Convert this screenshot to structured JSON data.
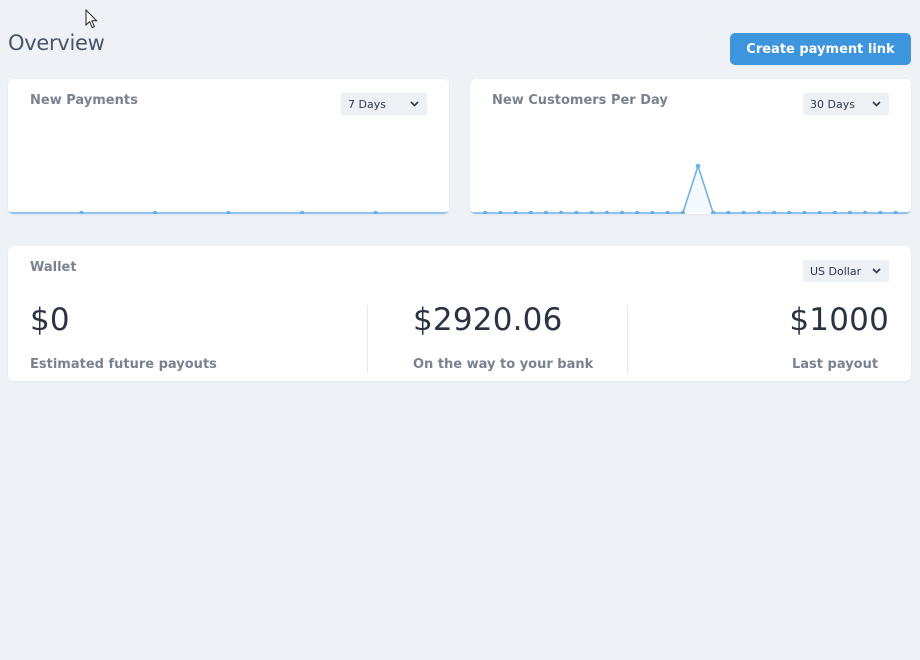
{
  "page": {
    "title": "Overview",
    "create_button_label": "Create payment link"
  },
  "new_payments": {
    "title": "New Payments",
    "range_select": "7 Days"
  },
  "new_customers": {
    "title": "New Customers Per Day",
    "range_select": "30 Days"
  },
  "wallet": {
    "title": "Wallet",
    "currency_select": "US Dollar",
    "stats": [
      {
        "amount": "$0",
        "label": "Estimated future payouts"
      },
      {
        "amount": "$2920.06",
        "label": "On the way to your bank"
      },
      {
        "amount": "$1000",
        "label": "Last payout"
      }
    ]
  },
  "chart_data": [
    {
      "type": "line",
      "title": "New Payments",
      "series": [
        {
          "values": [
            0,
            0,
            0,
            0,
            0,
            0,
            0
          ]
        }
      ],
      "ylim": [
        0,
        1
      ],
      "grid": false
    },
    {
      "type": "line",
      "title": "New Customers Per Day",
      "series": [
        {
          "values": [
            0,
            0,
            0,
            0,
            0,
            0,
            0,
            0,
            0,
            0,
            0,
            0,
            0,
            0,
            0,
            1,
            0,
            0,
            0,
            0,
            0,
            0,
            0,
            0,
            0,
            0,
            0,
            0,
            0,
            0
          ]
        }
      ],
      "ylim": [
        0,
        1
      ],
      "grid": false
    }
  ],
  "colors": {
    "accent": "#3d95dd",
    "line": "#6ab0e6",
    "background": "#eef2f7"
  },
  "icons": {
    "cursor": "arrow-cursor-icon",
    "chevron": "chevron-down-icon"
  }
}
